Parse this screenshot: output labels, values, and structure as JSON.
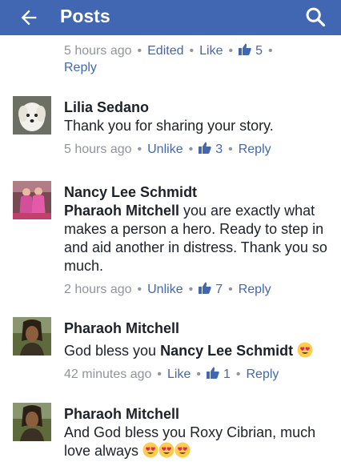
{
  "appbar": {
    "title": "Posts",
    "icons": [
      "back-arrow-icon",
      "search-icon"
    ],
    "bg": "#4267b2"
  },
  "first_meta": {
    "time": "5 hours ago",
    "edited": "Edited",
    "like": "Like",
    "likes": "5",
    "reply": "Reply"
  },
  "comments": [
    {
      "name": "Lilia Sedano",
      "text": "Thank you for sharing your story.",
      "time": "5 hours ago",
      "like": "Unlike",
      "likes": "3",
      "reply": "Reply"
    },
    {
      "name": "Nancy Lee Schmidt",
      "mention": "Pharaoh Mitchell",
      "text": " you are exactly what makes a person a hero.  Ready to step in and aid another in distress. Thank you so much.",
      "time": "2 hours ago",
      "like": "Unlike",
      "likes": "7",
      "reply": "Reply"
    },
    {
      "name": "Pharaoh Mitchell",
      "text_before": "God bless you ",
      "mention": "Nancy Lee Schmidt",
      "time": "42 minutes ago",
      "like": "Like",
      "likes": "1",
      "reply": "Reply"
    },
    {
      "name": "Pharaoh Mitchell",
      "text": "And God bless you Roxy Cibrian, much love always "
    }
  ]
}
